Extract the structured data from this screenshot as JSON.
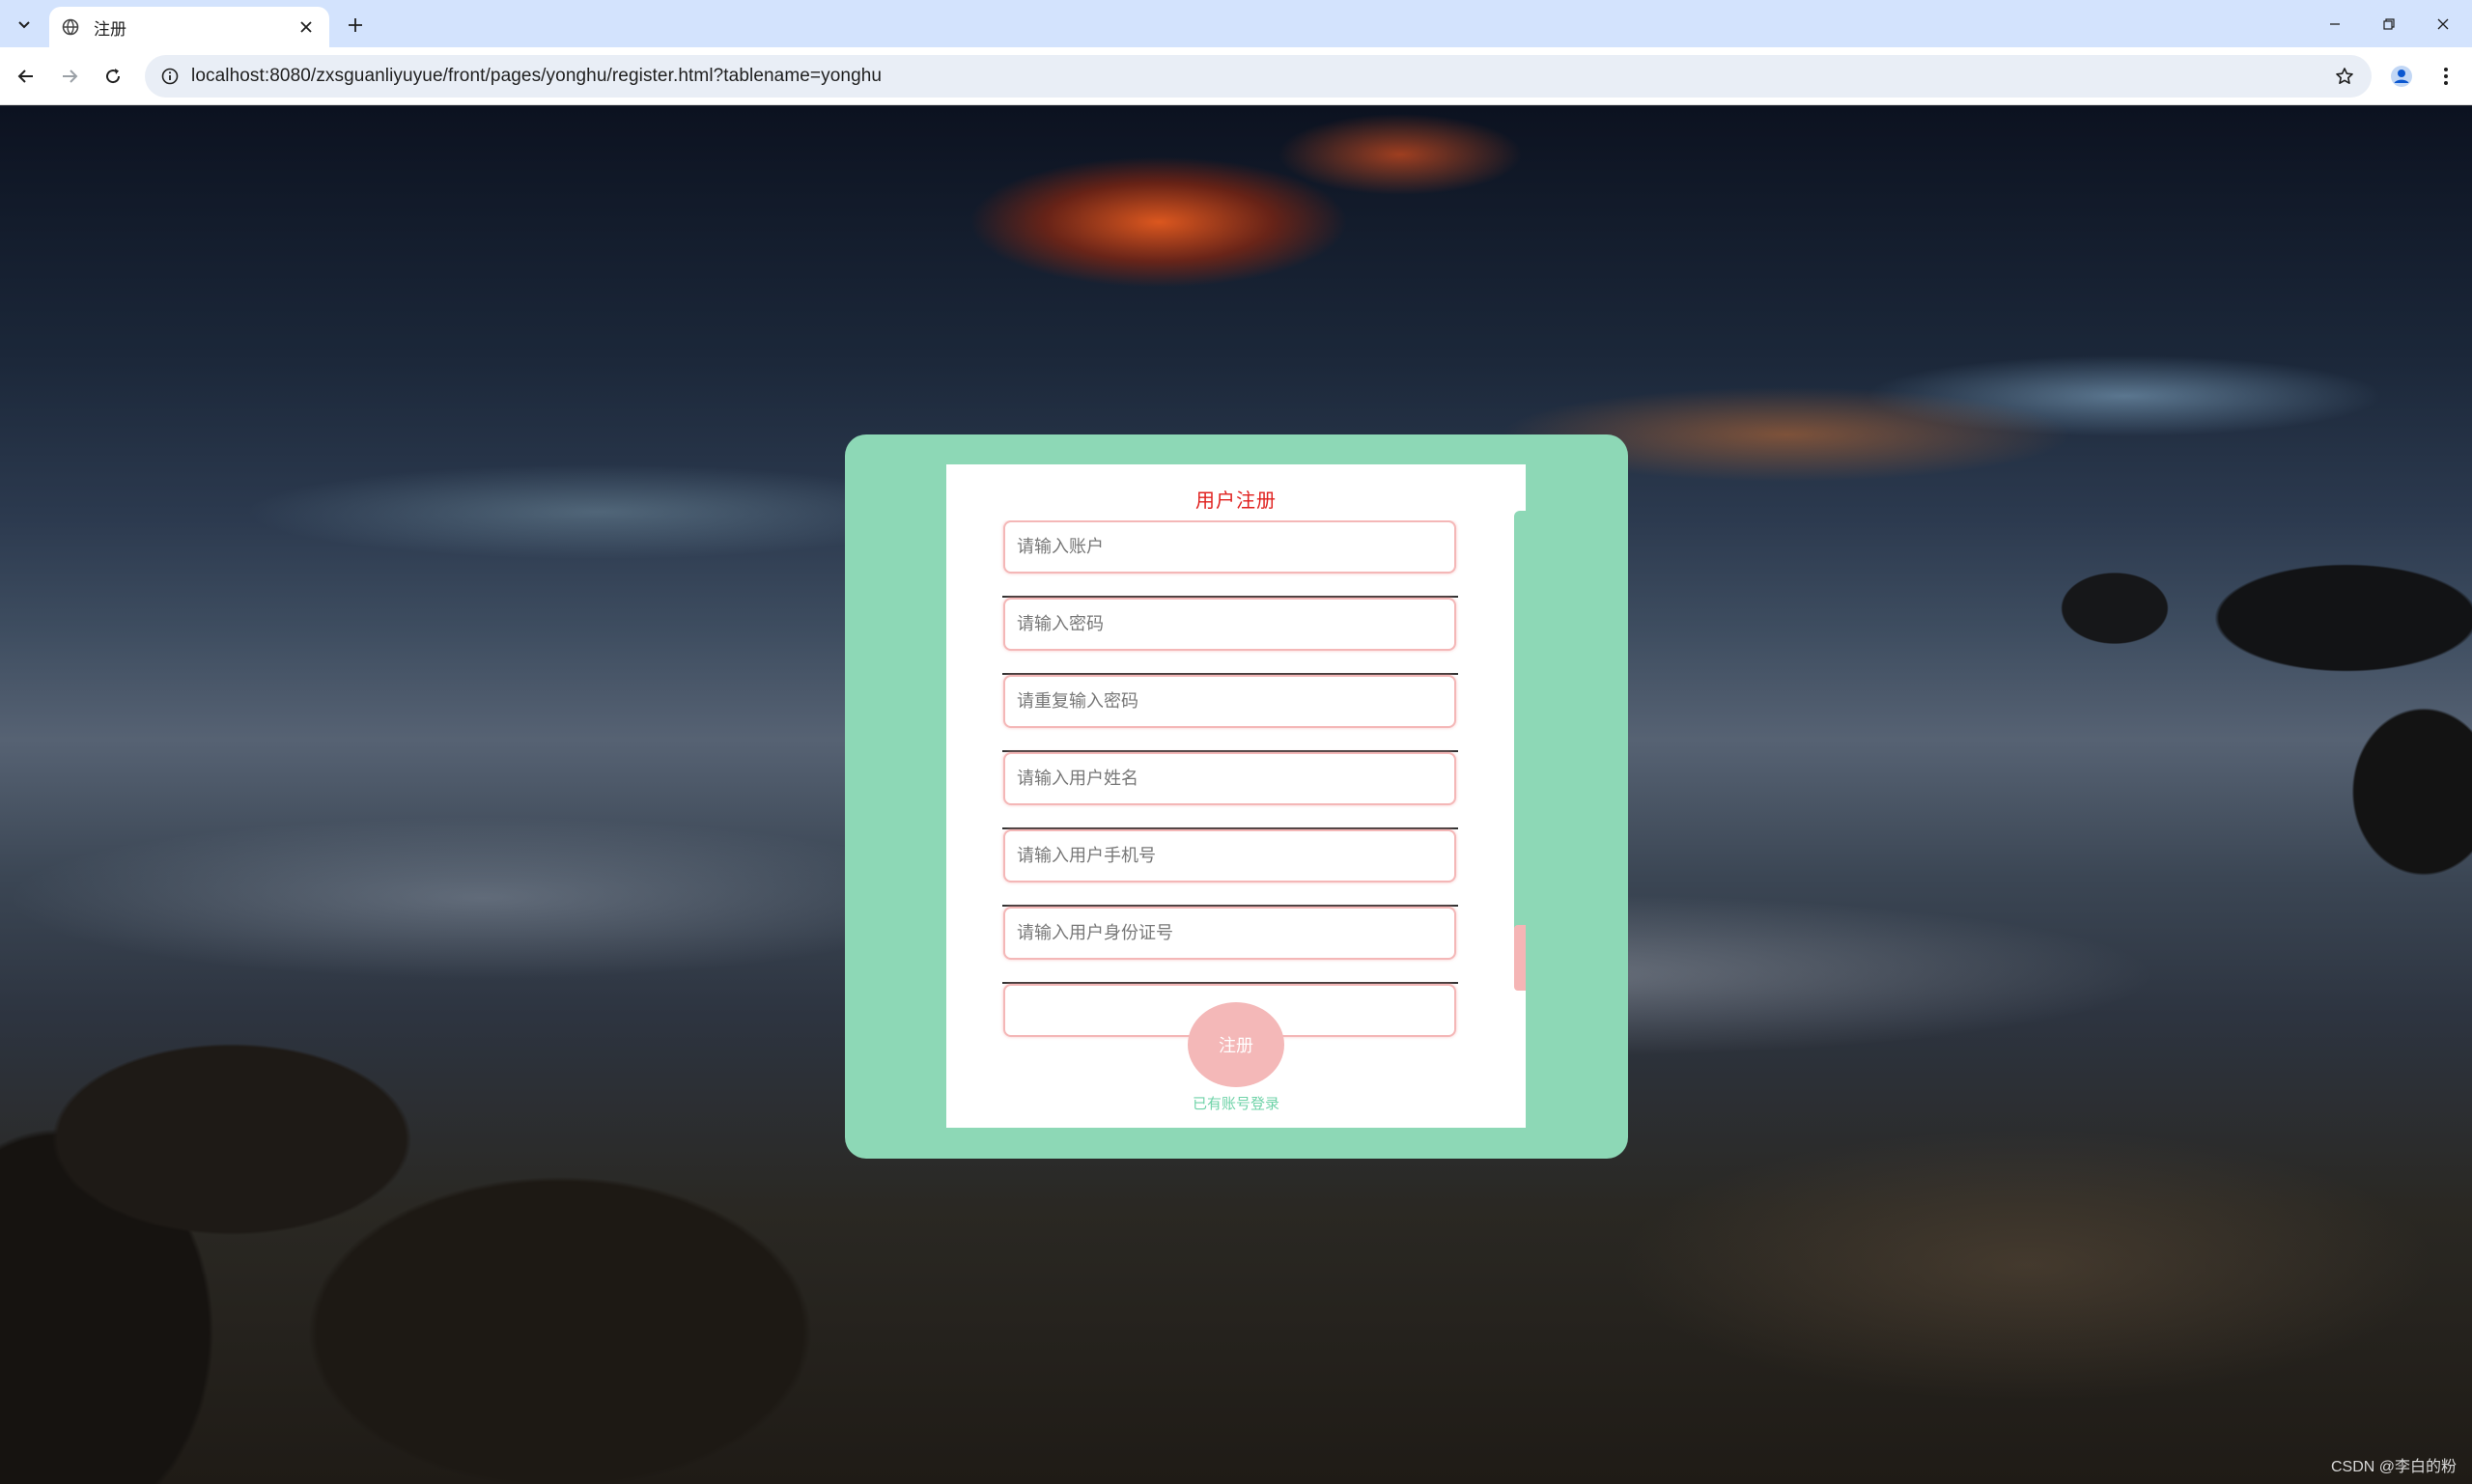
{
  "browser": {
    "tab_title": "注册",
    "url": "localhost:8080/zxsguanliyuyue/front/pages/yonghu/register.html?tablename=yonghu"
  },
  "form": {
    "title": "用户注册",
    "fields": [
      {
        "placeholder": "请输入账户"
      },
      {
        "placeholder": "请输入密码"
      },
      {
        "placeholder": "请重复输入密码"
      },
      {
        "placeholder": "请输入用户姓名"
      },
      {
        "placeholder": "请输入用户手机号"
      },
      {
        "placeholder": "请输入用户身份证号"
      },
      {
        "placeholder": ""
      }
    ],
    "submit_label": "注册",
    "login_link": "已有账号登录"
  },
  "watermark": "CSDN @李白的粉",
  "colors": {
    "card": "#8dd8b6",
    "title": "#e0201e",
    "field_border": "#f4b7b7",
    "button": "#f4b8b8",
    "link": "#6fd3a8"
  }
}
